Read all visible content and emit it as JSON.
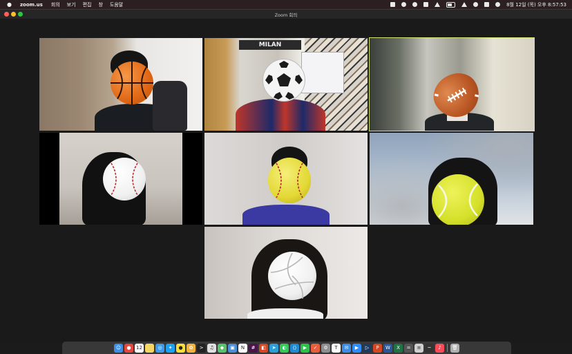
{
  "menubar": {
    "app_name": "zoom.us",
    "menus": [
      "회의",
      "보기",
      "편집",
      "창",
      "도움말"
    ],
    "clock": "8월 12일 (목) 오후 8:57:53",
    "tray_icons": [
      "zoom-icon",
      "vpn-icon",
      "screen-record-icon",
      "bluetooth-icon",
      "volume-icon",
      "wifi-icon",
      "search-icon",
      "control-center-icon",
      "siri-icon",
      "time-machine-icon",
      "battery-icon"
    ]
  },
  "window": {
    "title": "Zoom 회의",
    "active_tile": "tile-football"
  },
  "tiles": [
    {
      "id": "tile-basketball",
      "filter": "basketball"
    },
    {
      "id": "tile-soccer",
      "filter": "soccer-ball",
      "poster_text": "MILAN"
    },
    {
      "id": "tile-football",
      "filter": "football"
    },
    {
      "id": "tile-baseball",
      "filter": "baseball"
    },
    {
      "id": "tile-softball",
      "filter": "softball"
    },
    {
      "id": "tile-tennis",
      "filter": "tennis-ball"
    },
    {
      "id": "tile-volleyball",
      "filter": "volleyball"
    }
  ],
  "dock": {
    "apps": [
      {
        "name": "finder",
        "color": "#3b8ee8",
        "glyph": "☺"
      },
      {
        "name": "chrome",
        "color": "#e8453c",
        "glyph": "●"
      },
      {
        "name": "calendar",
        "color": "#ffffff",
        "glyph": "12"
      },
      {
        "name": "notes",
        "color": "#f5d665",
        "glyph": ""
      },
      {
        "name": "safari",
        "color": "#3d9be9",
        "glyph": "◎"
      },
      {
        "name": "twitter",
        "color": "#1da1f2",
        "glyph": "✦"
      },
      {
        "name": "kakaotalk",
        "color": "#f7e03c",
        "glyph": "●"
      },
      {
        "name": "photos",
        "color": "#f2b33d",
        "glyph": "✿"
      },
      {
        "name": "terminal",
        "color": "#222222",
        "glyph": ">"
      },
      {
        "name": "music-box",
        "color": "#e0e0e0",
        "glyph": "♫"
      },
      {
        "name": "maps",
        "color": "#5cbf6c",
        "glyph": "◆"
      },
      {
        "name": "preview",
        "color": "#4a90d9",
        "glyph": "▣"
      },
      {
        "name": "notion",
        "color": "#ffffff",
        "glyph": "N"
      },
      {
        "name": "slack",
        "color": "#4a154b",
        "glyph": "#"
      },
      {
        "name": "office",
        "color": "#d24726",
        "glyph": "◧"
      },
      {
        "name": "telegram",
        "color": "#2aa0da",
        "glyph": "➤"
      },
      {
        "name": "messages",
        "color": "#34c759",
        "glyph": "◐"
      },
      {
        "name": "vscode",
        "color": "#1f8ad2",
        "glyph": "⟨⟩"
      },
      {
        "name": "facetime",
        "color": "#2bc24a",
        "glyph": "▶"
      },
      {
        "name": "todo",
        "color": "#e85d3b",
        "glyph": "✓"
      },
      {
        "name": "settings",
        "color": "#8e8e93",
        "glyph": "⚙"
      },
      {
        "name": "typora",
        "color": "#ffffff",
        "glyph": "T"
      },
      {
        "name": "mail",
        "color": "#3b8ee8",
        "glyph": "✉"
      },
      {
        "name": "zoom",
        "color": "#2d8cff",
        "glyph": "▶"
      },
      {
        "name": "quicktime",
        "color": "#1f3a5f",
        "glyph": "▷"
      },
      {
        "name": "powerpoint",
        "color": "#d24726",
        "glyph": "P"
      },
      {
        "name": "word",
        "color": "#2b579a",
        "glyph": "W"
      },
      {
        "name": "excel",
        "color": "#217346",
        "glyph": "X"
      },
      {
        "name": "calculator",
        "color": "#555555",
        "glyph": "="
      },
      {
        "name": "database",
        "color": "#cfcfcf",
        "glyph": "≡"
      },
      {
        "name": "activity-monitor",
        "color": "#333333",
        "glyph": "~"
      },
      {
        "name": "itunes",
        "color": "#fa4b5b",
        "glyph": "♪"
      },
      {
        "name": "trash",
        "color": "#b0b0b0",
        "glyph": "🗑"
      }
    ]
  }
}
